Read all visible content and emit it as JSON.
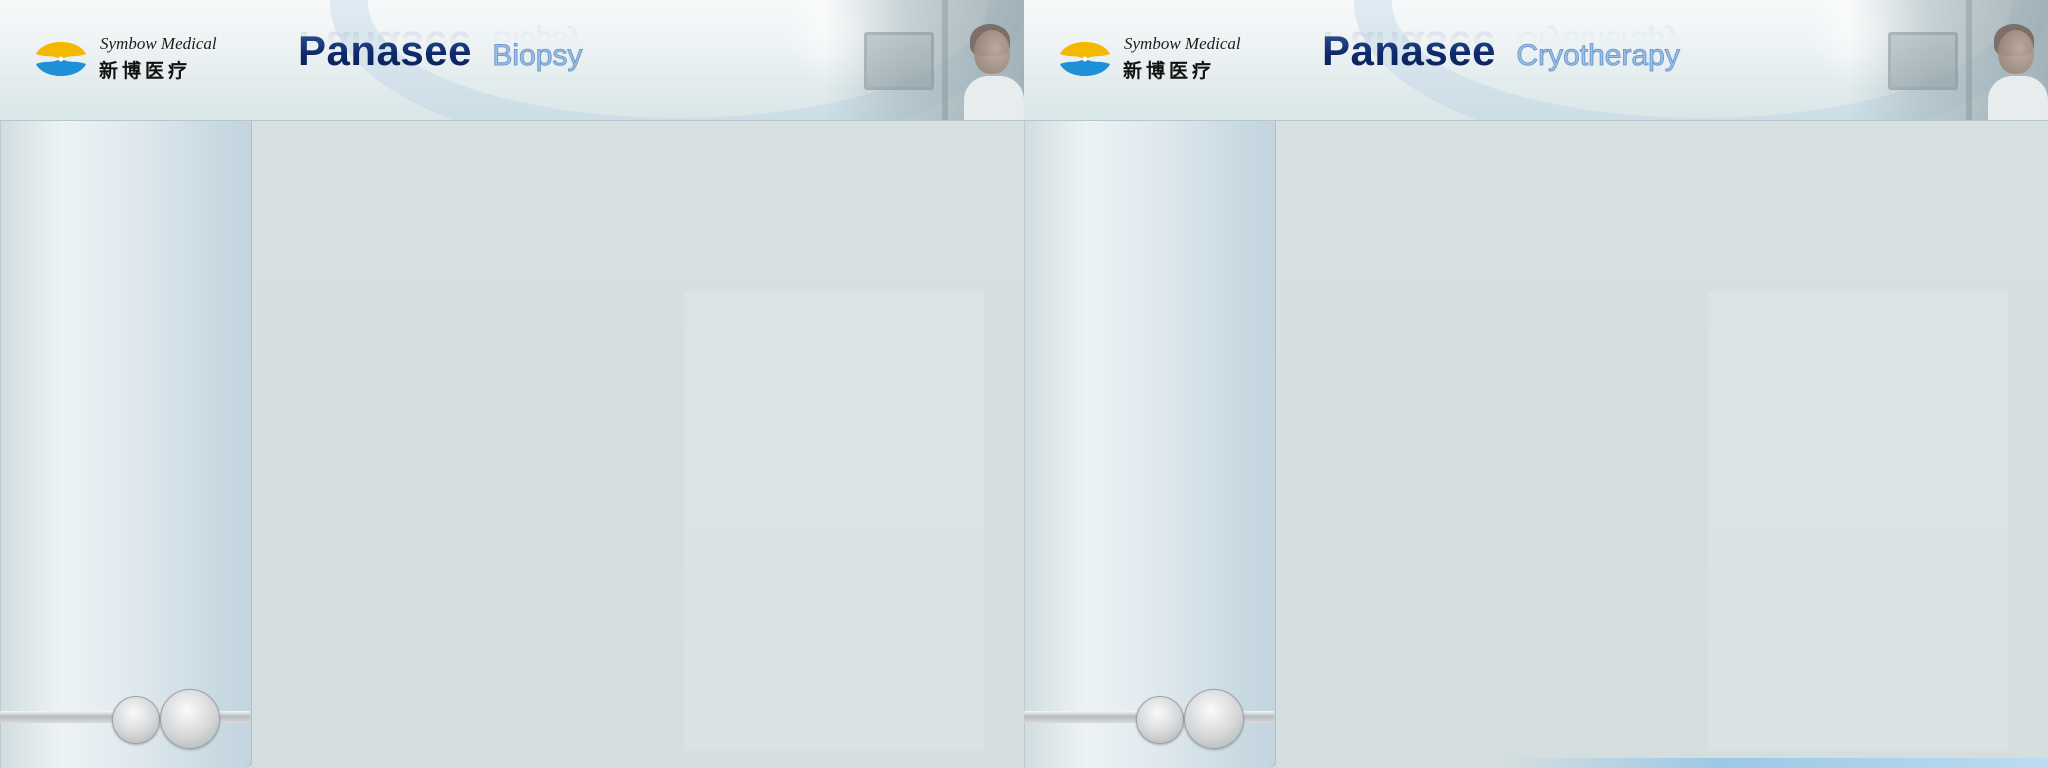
{
  "screens": [
    {
      "company": {
        "name_en": "Symbow Medical",
        "name_cn": "新博医疗",
        "logo_icon": "symbow-logo-icon"
      },
      "product": {
        "brand": "Panasee",
        "mode": "Biopsy"
      },
      "sidebar": {
        "knob_icons": [
          "round-knob-icon",
          "round-knob-icon"
        ]
      }
    },
    {
      "company": {
        "name_en": "Symbow Medical",
        "name_cn": "新博医疗",
        "logo_icon": "symbow-logo-icon"
      },
      "product": {
        "brand": "Panasee",
        "mode": "Cryotherapy"
      },
      "sidebar": {
        "knob_icons": [
          "round-knob-icon",
          "round-knob-icon"
        ]
      }
    }
  ],
  "colors": {
    "logo_yellow": "#f5b800",
    "logo_blue": "#1e90d8",
    "brand_navy": "#0e2a6b",
    "mode_lightblue": "#9cc0e6",
    "content_bg": "#d6dfe0"
  }
}
